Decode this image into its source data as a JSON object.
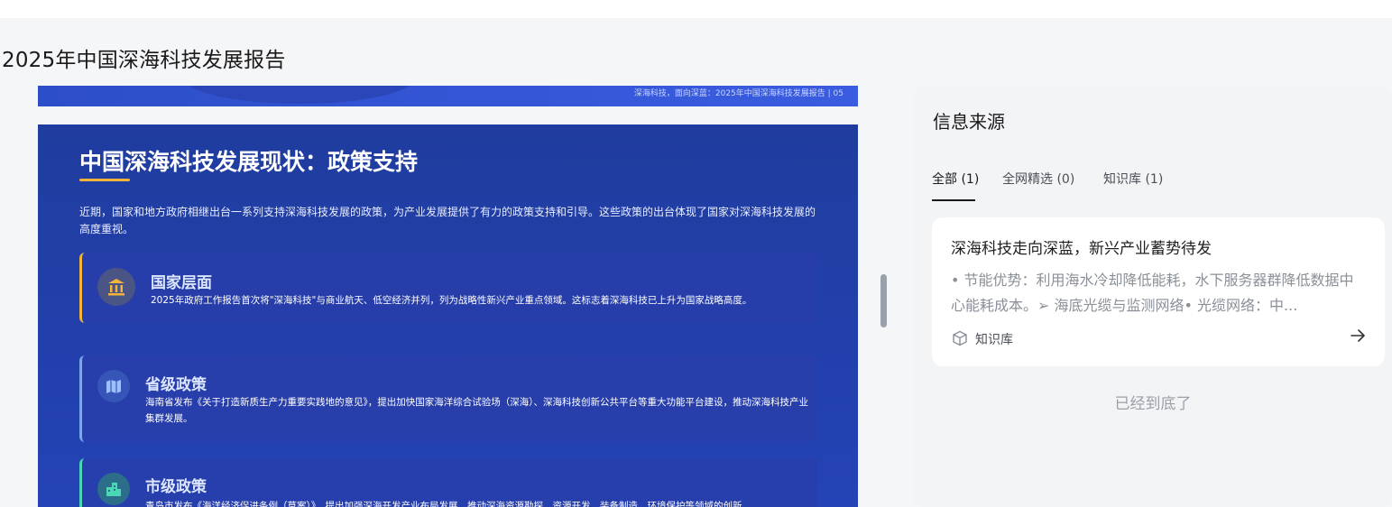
{
  "page": {
    "title": "2025年中国深海科技发展报告"
  },
  "slide_prev": {
    "footer": "深海科技，面向深蓝：2025年中国深海科技发展报告 | 05"
  },
  "slide": {
    "heading": "中国深海科技发展现状：政策支持",
    "intro": "近期，国家和地方政府相继出台一系列支持深海科技发展的政策，为产业发展提供了有力的政策支持和引导。这些政策的出台体现了国家对深海科技发展的高度重视。",
    "cards": [
      {
        "icon": "bank-icon",
        "glyph": "🏛",
        "title": "国家层面",
        "text": "2025年政府工作报告首次将\"深海科技\"与商业航天、低空经济并列，列为战略性新兴产业重点领域。这标志着深海科技已上升为国家战略高度。"
      },
      {
        "icon": "map-icon",
        "glyph": "🗺",
        "title": "省级政策",
        "text": "海南省发布《关于打造新质生产力重要实践地的意见》，提出加快国家海洋综合试验场（深海）、深海科技创新公共平台等重大功能平台建设，推动深海科技产业集群发展。"
      },
      {
        "icon": "city-icon",
        "glyph": "🏙",
        "title": "市级政策",
        "text": "青岛市发布《海洋经济促进条例（草案）》，提出加强深海开发产业布局发展，推动深海资源勘探、资源开发、装备制造、环境保护等领域的创新"
      }
    ]
  },
  "sources": {
    "title": "信息来源",
    "tabs": [
      {
        "label": "全部 (1)",
        "active": true
      },
      {
        "label": "全网精选 (0)",
        "active": false
      },
      {
        "label": "知识库 (1)",
        "active": false
      }
    ],
    "items": [
      {
        "title": "深海科技走向深蓝，新兴产业蓄势待发",
        "snippet": "• 节能优势：利用海水冷却降低能耗，水下服务器群降低数据中心能耗成本。➢ 海底光缆与监测网络• 光缆网络：中...",
        "source_label": "知识库",
        "icon": "cube-icon",
        "action_icon": "arrow-right-icon"
      }
    ],
    "end_text": "已经到底了"
  }
}
